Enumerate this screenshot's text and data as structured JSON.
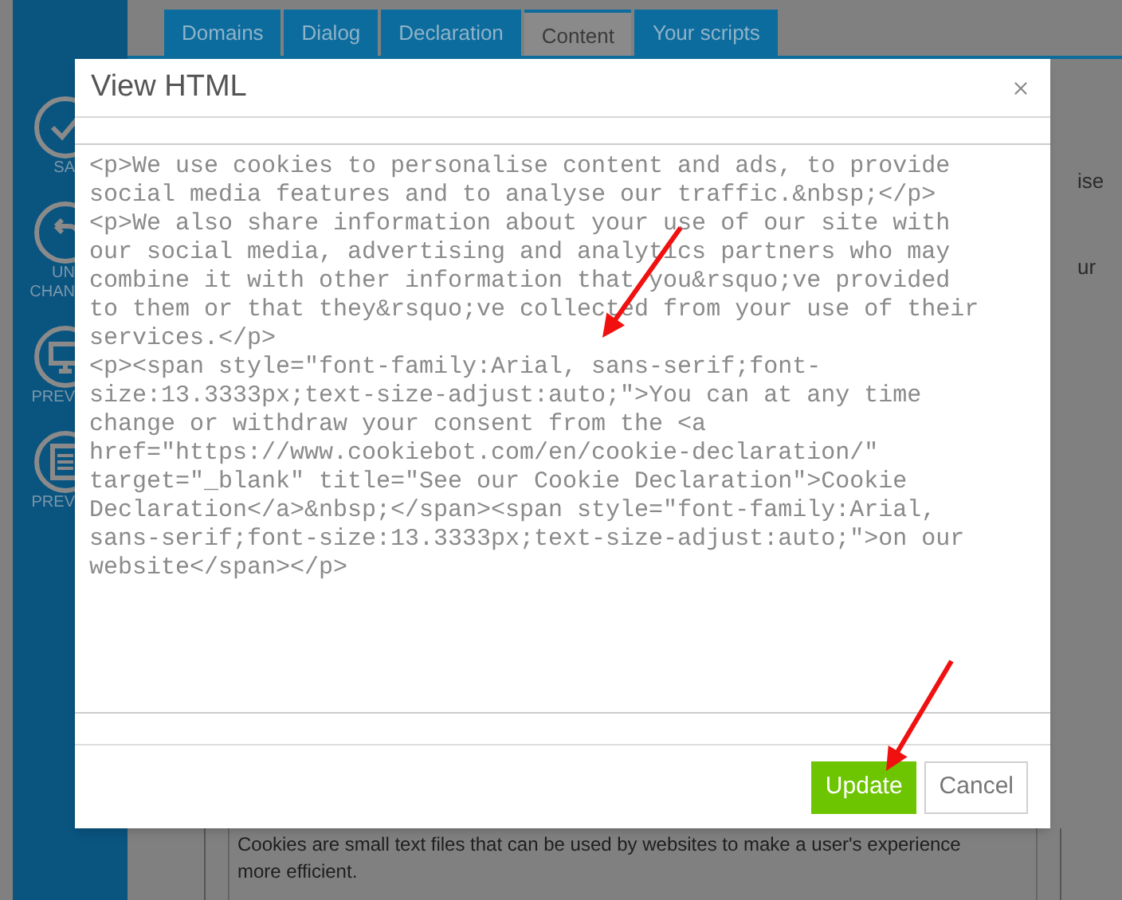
{
  "sidebar": {
    "items": [
      {
        "kind": "check",
        "label": [
          "SA"
        ]
      },
      {
        "kind": "undo",
        "label": [
          "UN",
          "CHAN"
        ]
      },
      {
        "kind": "monitor",
        "label": [
          "PREV"
        ]
      },
      {
        "kind": "document",
        "label": [
          "PREV"
        ]
      }
    ]
  },
  "tabs": [
    {
      "label": "Domains",
      "selected": false
    },
    {
      "label": "Dialog",
      "selected": false
    },
    {
      "label": "Declaration",
      "selected": false
    },
    {
      "label": "Content",
      "selected": true
    },
    {
      "label": "Your scripts",
      "selected": false
    }
  ],
  "side_fragments": [
    "ise",
    "ur"
  ],
  "content_text": "Cookies are small text files that can be used by websites to make a user's experience more efficient.",
  "dialog": {
    "title": "View HTML",
    "html": "<p>We use cookies to personalise content and ads, to provide social media features and to analyse our traffic.&nbsp;</p>\n<p>We also share information about your use of our site with our social media, advertising and analytics partners who may combine it with other information that you&rsquo;ve provided to them or that they&rsquo;ve collected from your use of their services.</p>\n<p><span style=\"font-family:Arial, sans-serif;font-size:13.3333px;text-size-adjust:auto;\">You can at any time change or withdraw your consent from the <a href=\"https://www.cookiebot.com/en/cookie-declaration/\" target=\"_blank\" title=\"See our Cookie Declaration\">Cookie Declaration</a>&nbsp;</span><span style=\"font-family:Arial, sans-serif;font-size:13.3333px;text-size-adjust:auto;\">on our website</span></p>",
    "buttons": [
      {
        "label": "Update",
        "kind": "primary"
      },
      {
        "label": "Cancel",
        "kind": "secondary"
      }
    ]
  }
}
